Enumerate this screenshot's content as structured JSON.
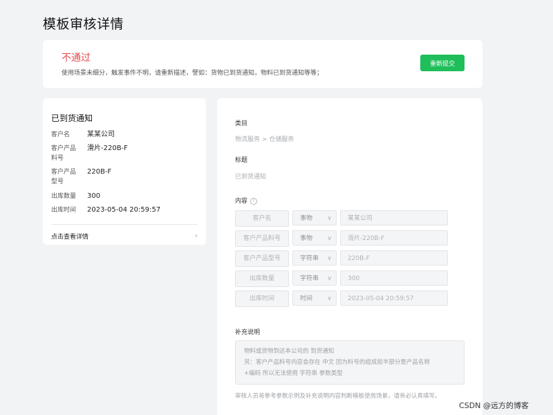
{
  "page_title": "模板审核详情",
  "status": {
    "title": "不通过",
    "reason": "使用场景未细分，触发事件不明，请重新描述，譬如：货物已到货通知，物料已到货通知等等；",
    "resubmit_label": "重新提交"
  },
  "left_card": {
    "title": "已到货通知",
    "rows": [
      {
        "label": "客户名",
        "value": "某某公司"
      },
      {
        "label": "客户产品料号",
        "value": "滑片-220B-F"
      },
      {
        "label": "客户产品型号",
        "value": "220B-F"
      },
      {
        "label": "出库数量",
        "value": "300"
      },
      {
        "label": "出库时间",
        "value": "2023-05-04 20:59:57"
      }
    ],
    "detail_link": "点击查看详情",
    "detail_chevron": "›"
  },
  "right_card": {
    "category_label": "类目",
    "category_value": "物流服务 > 仓储服务",
    "title_label": "标题",
    "title_value": "已到货通知",
    "content_label": "内容",
    "help_glyph": "?",
    "fields": [
      {
        "name": "客户名",
        "type": "事物",
        "value": "某某公司"
      },
      {
        "name": "客户产品料号",
        "type": "事物",
        "value": "滑片-220B-F"
      },
      {
        "name": "客户产品型号",
        "type": "字符串",
        "value": "220B-F"
      },
      {
        "name": "出库数量",
        "type": "字符串",
        "value": "300"
      },
      {
        "name": "出库时间",
        "type": "时间",
        "value": "2023-05-04 20:59:57"
      }
    ],
    "dropdown_glyph": "∨",
    "supplement_label": "补充说明",
    "supplement_lines": [
      "物料或货物到达本公司的 到货通知",
      "另：客户产品料号内容会存在 中文 因为料号的组成前半部分是产品名称",
      "+编码 所以无法使用 字符串 参数类型"
    ],
    "footer_note": "审核人员将参考参数示例及补充说明内容判断模板使用场景，请务必认真填写。"
  },
  "watermark": "CSDN @远方的博客",
  "colors": {
    "background": "#f2f3f5",
    "reject_red": "#e34d4d",
    "button_green": "#1fbe5a"
  }
}
